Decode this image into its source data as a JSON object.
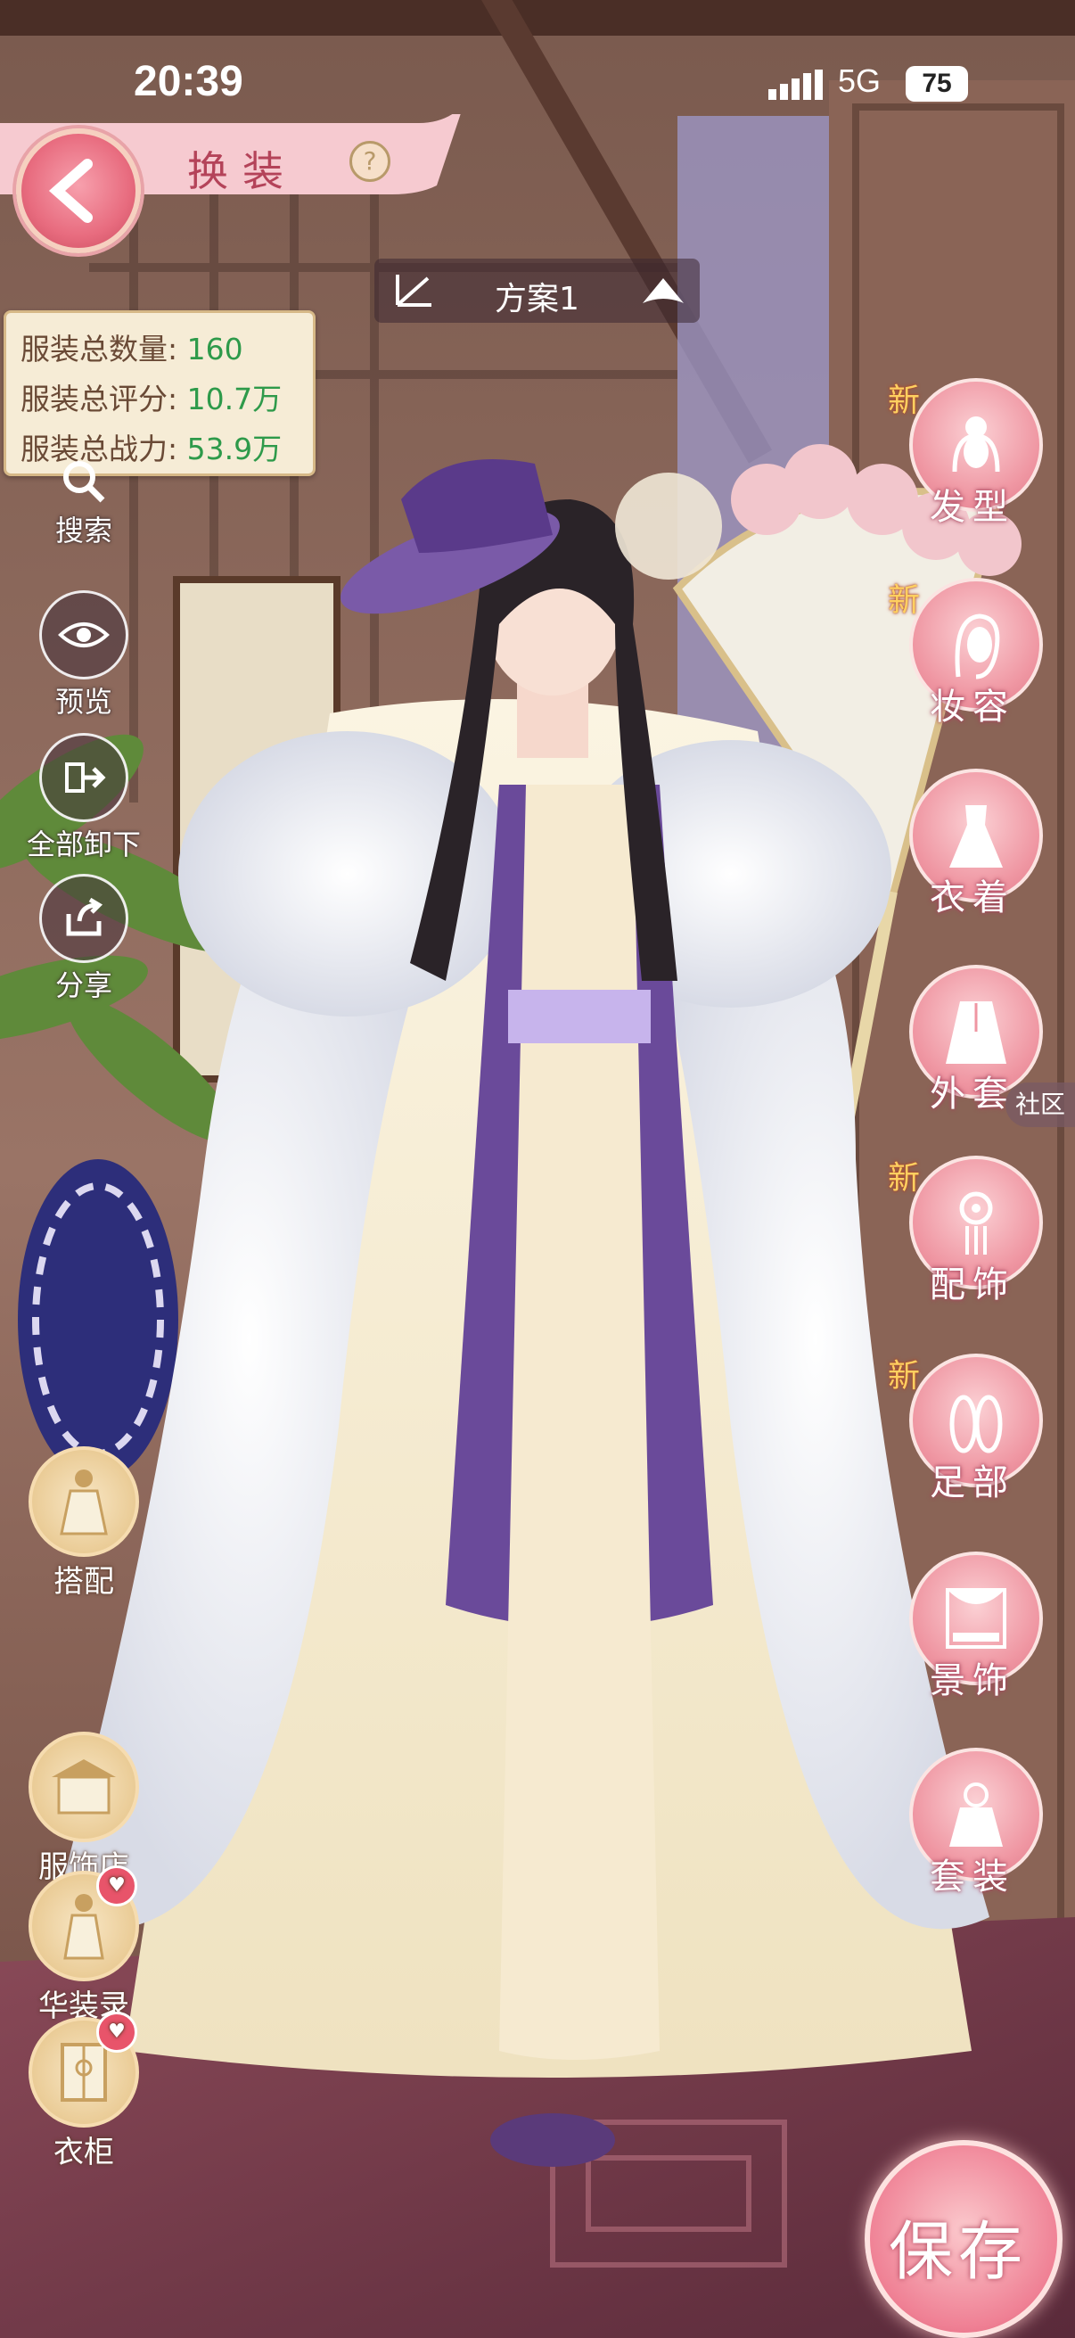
{
  "status_bar": {
    "time": "20:39",
    "network": "5G",
    "battery": "75"
  },
  "header": {
    "title": "换装",
    "help": "?"
  },
  "plan_selector": {
    "label": "方案1"
  },
  "stats": [
    {
      "label": "服装总数量:",
      "value": "160"
    },
    {
      "label": "服装总评分:",
      "value": "10.7万"
    },
    {
      "label": "服装总战力:",
      "value": "53.9万"
    }
  ],
  "left_tools": [
    {
      "label": "搜索",
      "icon": "search-icon"
    },
    {
      "label": "预览",
      "icon": "eye-icon"
    },
    {
      "label": "全部卸下",
      "icon": "unequip-all-icon"
    },
    {
      "label": "分享",
      "icon": "share-icon"
    }
  ],
  "left_features": [
    {
      "label": "搭配",
      "icon": "outfit-match-icon"
    },
    {
      "label": "服饰店",
      "icon": "shop-icon"
    },
    {
      "label": "华装录",
      "icon": "collection-icon"
    },
    {
      "label": "衣柜",
      "icon": "wardrobe-icon"
    }
  ],
  "categories": [
    {
      "label": "发型",
      "new": "新",
      "icon": "hairstyle-icon"
    },
    {
      "label": "妆容",
      "new": "新",
      "icon": "makeup-icon"
    },
    {
      "label": "衣着",
      "new": "",
      "icon": "dress-icon"
    },
    {
      "label": "外套",
      "new": "",
      "icon": "coat-icon"
    },
    {
      "label": "配饰",
      "new": "新",
      "icon": "accessory-icon"
    },
    {
      "label": "足部",
      "new": "新",
      "icon": "shoes-icon"
    },
    {
      "label": "景饰",
      "new": "",
      "icon": "scenery-icon"
    },
    {
      "label": "套装",
      "new": "",
      "icon": "suit-icon"
    }
  ],
  "community_tab": "社区",
  "save_button": "保存"
}
